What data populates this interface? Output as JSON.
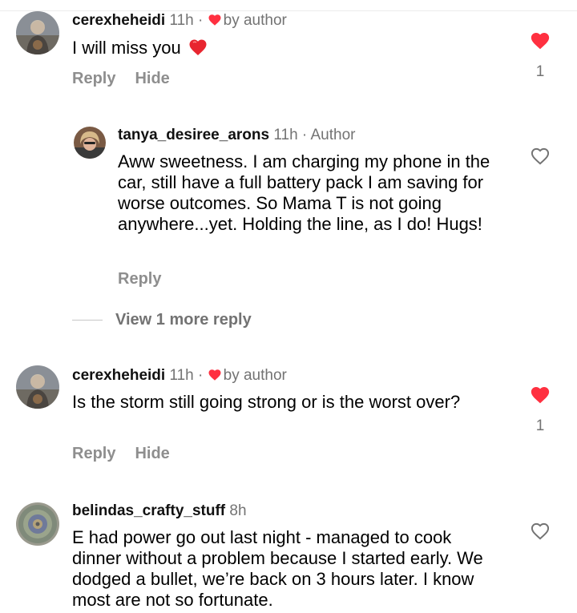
{
  "comments": [
    {
      "username": "cerexheheidi",
      "time": "11h",
      "sep": "·",
      "liked_by_author": "by author",
      "text": "I will  miss you",
      "actions": [
        "Reply",
        "Hide"
      ],
      "likes": "1",
      "liked": true
    },
    {
      "username": "tanya_desiree_arons",
      "time": "11h",
      "sep": "·",
      "role": "Author",
      "text": "Aww sweetness.  I am charging my phone in the car, still have a full battery pack I am saving for worse outcomes. So Mama T is not going anywhere...yet.  Holding the line, as I do! Hugs!",
      "actions": [
        "Reply"
      ],
      "liked": false
    },
    {
      "username": "cerexheheidi",
      "time": "11h",
      "sep": "·",
      "liked_by_author": "by author",
      "text": "Is the storm still going strong or is the worst over?",
      "actions": [
        "Reply",
        "Hide"
      ],
      "likes": "1",
      "liked": true
    },
    {
      "username": "belindas_crafty_stuff",
      "time": "8h",
      "text": "E had power go out last night - managed to cook dinner without a problem because I started early. We dodged a bullet, we’re back on 3 hours later. I know most are not so fortunate.",
      "liked": false
    }
  ],
  "view_more": "View 1 more reply",
  "colors": {
    "like_red": "#ff3040",
    "muted": "#737373",
    "action": "#8e8e8e"
  },
  "icons": [
    "heart-filled-icon",
    "heart-outline-icon",
    "red-heart-emoji"
  ]
}
